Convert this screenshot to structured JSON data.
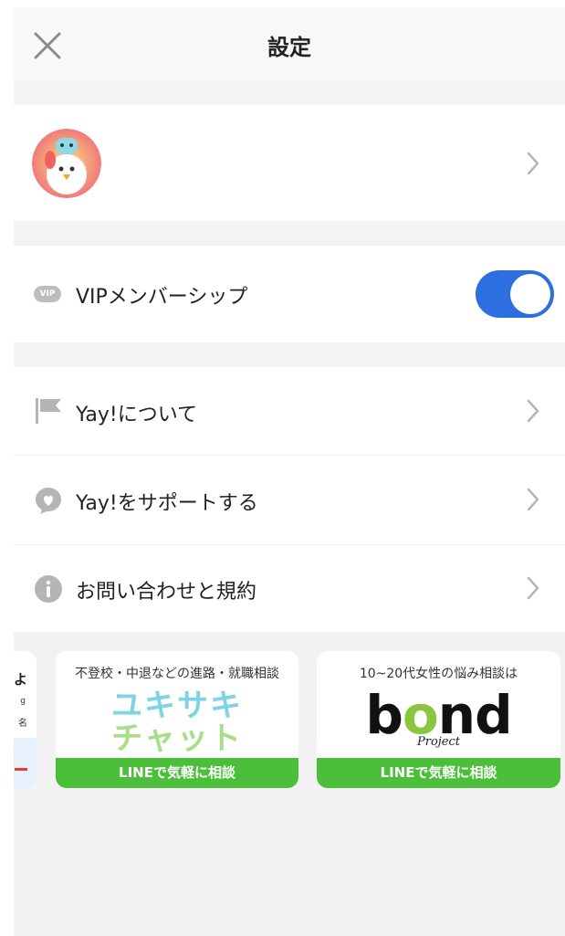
{
  "header": {
    "title": "設定",
    "close_icon": "close-icon"
  },
  "profile": {
    "avatar_icon": "avatar"
  },
  "vip": {
    "badge": "VIP",
    "label": "VIPメンバーシップ",
    "toggle_on": true,
    "accent": "#2d6fe0"
  },
  "menu": [
    {
      "icon": "flag-icon",
      "label": "Yay!について"
    },
    {
      "icon": "chat-heart-icon",
      "label": "Yay!をサポートする"
    },
    {
      "icon": "info-icon",
      "label": "お問い合わせと規約"
    }
  ],
  "banners": [
    {
      "partial_title": "よ",
      "partial_line1": "g",
      "partial_line2": "名"
    },
    {
      "caption": "不登校・中退などの進路・就職相談",
      "logo_line1": "ユキサキ",
      "logo_line2": "チャット",
      "cta": "LINEで気軽に相談"
    },
    {
      "caption": "10~20代女性の悩み相談は",
      "logo_b": "b",
      "logo_o": "o",
      "logo_nd": "nd",
      "logo_sub": "Project",
      "cta": "LINEで気軽に相談"
    }
  ],
  "colors": {
    "cta_green": "#4cbf3a",
    "toggle_blue": "#2d6fe0"
  }
}
